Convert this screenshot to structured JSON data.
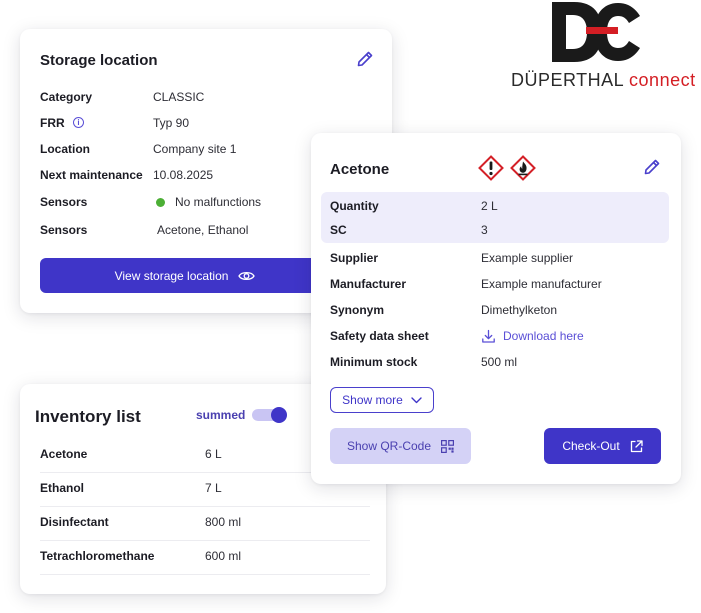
{
  "logo": {
    "brand": "DÜPERTHAL",
    "suffix": "connect",
    "mark": "DC"
  },
  "storage": {
    "title": "Storage location",
    "rows": [
      {
        "label": "Category",
        "value": "CLASSIC"
      },
      {
        "label": "FRR",
        "value": "Typ 90"
      },
      {
        "label": "Location",
        "value": "Company site 1"
      },
      {
        "label": "Next maintenance",
        "value": "10.08.2025"
      },
      {
        "label": "Sensors",
        "value": "No malfunctions"
      },
      {
        "label": "Sensors",
        "value": "Acetone, Ethanol"
      }
    ],
    "button": "View storage location"
  },
  "acetone": {
    "title": "Acetone",
    "hazard_icons": [
      "exclamation-mark-hazard-icon",
      "flammable-hazard-icon"
    ],
    "rows": [
      {
        "label": "Quantity",
        "value": "2 L"
      },
      {
        "label": "SC",
        "value": "3"
      },
      {
        "label": "Supplier",
        "value": "Example supplier"
      },
      {
        "label": "Manufacturer",
        "value": "Example manufacturer"
      },
      {
        "label": "Synonym",
        "value": "Dimethylketon"
      },
      {
        "label": "Safety data sheet",
        "value": "Download here"
      },
      {
        "label": "Minimum stock",
        "value": "500 ml"
      }
    ],
    "show_more": "Show more",
    "qr_button": "Show QR-Code",
    "checkout_button": "Check-Out"
  },
  "inventory": {
    "title": "Inventory list",
    "toggle_label": "summed",
    "toggle_on": true,
    "items": [
      {
        "name": "Acetone",
        "amount": "6 L"
      },
      {
        "name": "Ethanol",
        "amount": "7 L"
      },
      {
        "name": "Disinfectant",
        "amount": "800 ml"
      },
      {
        "name": "Tetrachloromethane",
        "amount": "600 ml"
      }
    ]
  },
  "colors": {
    "accent": "#3f35c8",
    "accent_light": "#d4d2f6",
    "highlight": "#eeedfb",
    "brand_red": "#d41e24",
    "ok_green": "#4caf35",
    "hazard_red": "#d42027"
  }
}
